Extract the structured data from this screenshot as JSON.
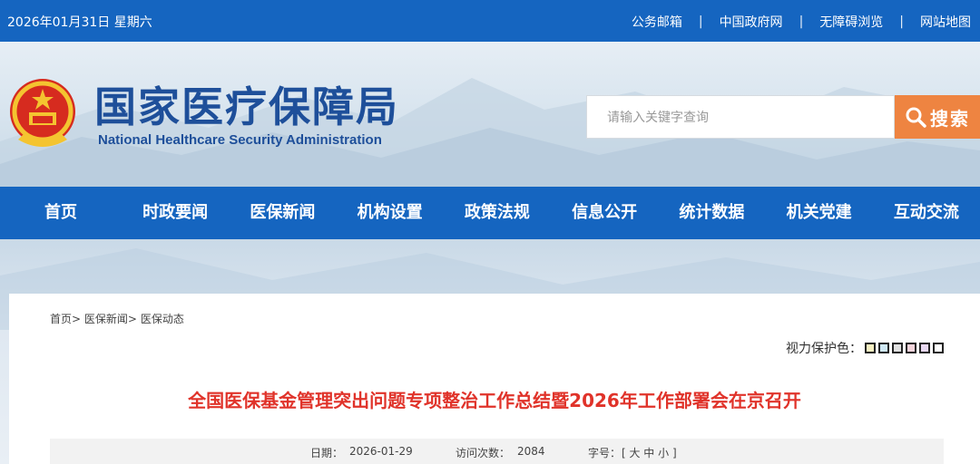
{
  "topbar": {
    "date": "2026年01月31日 星期六",
    "links": [
      "公务邮箱",
      "中国政府网",
      "无障碍浏览",
      "网站地图"
    ],
    "separator": "|"
  },
  "header": {
    "title_cn": "国家医疗保障局",
    "title_en": "National Healthcare Security Administration",
    "search_placeholder": "请输入关键字查询",
    "search_button": "搜索"
  },
  "nav": [
    "首页",
    "时政要闻",
    "医保新闻",
    "机构设置",
    "政策法规",
    "信息公开",
    "统计数据",
    "机关党建",
    "互动交流"
  ],
  "breadcrumb": [
    "首页",
    "医保新闻",
    "医保动态"
  ],
  "breadcrumb_sep": ">",
  "eye_protect": {
    "label": "视力保护色：",
    "colors": [
      "#f7f0c2",
      "#cfe8f5",
      "#e0e0e0",
      "#f5d5dc",
      "#e8d8f2",
      "#ffffff"
    ]
  },
  "article": {
    "title": "全国医保基金管理突出问题专项整治工作总结暨2026年工作部署会在京召开",
    "date_label": "日期：",
    "date": "2026-01-29",
    "views_label": "访问次数：",
    "views": "2084",
    "font_label": "字号：",
    "font_options": "[ 大 中 小 ]"
  }
}
